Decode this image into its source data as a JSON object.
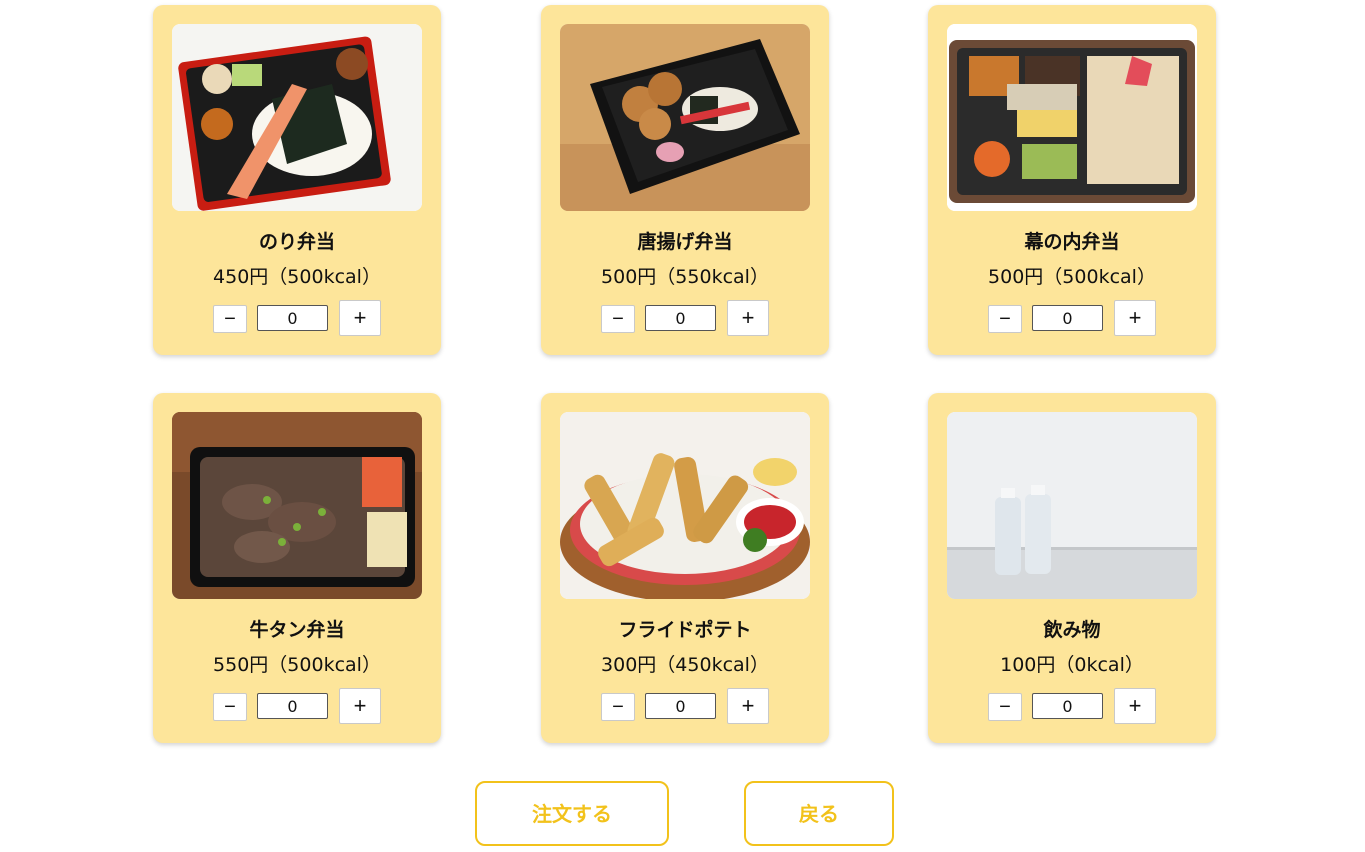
{
  "menu": {
    "items": [
      {
        "name": "のり弁当",
        "price": "450円（500kcal）",
        "quantity": "0",
        "minus_label": "−",
        "plus_label": "+",
        "photo_icon": "nori-bento-photo"
      },
      {
        "name": "唐揚げ弁当",
        "price": "500円（550kcal）",
        "quantity": "0",
        "minus_label": "−",
        "plus_label": "+",
        "photo_icon": "karaage-bento-photo"
      },
      {
        "name": "幕の内弁当",
        "price": "500円（500kcal）",
        "quantity": "0",
        "minus_label": "−",
        "plus_label": "+",
        "photo_icon": "makunouchi-bento-photo"
      },
      {
        "name": "牛タン弁当",
        "price": "550円（500kcal）",
        "quantity": "0",
        "minus_label": "−",
        "plus_label": "+",
        "photo_icon": "gyutan-bento-photo"
      },
      {
        "name": "フライドポテト",
        "price": "300円（450kcal）",
        "quantity": "0",
        "minus_label": "−",
        "plus_label": "+",
        "photo_icon": "french-fries-photo"
      },
      {
        "name": "飲み物",
        "price": "100円（0kcal）",
        "quantity": "0",
        "minus_label": "−",
        "plus_label": "+",
        "photo_icon": "water-bottles-photo"
      }
    ]
  },
  "actions": {
    "order_label": "注文する",
    "back_label": "戻る"
  },
  "colors": {
    "card_background": "#fde59a",
    "accent": "#f2c21b"
  }
}
